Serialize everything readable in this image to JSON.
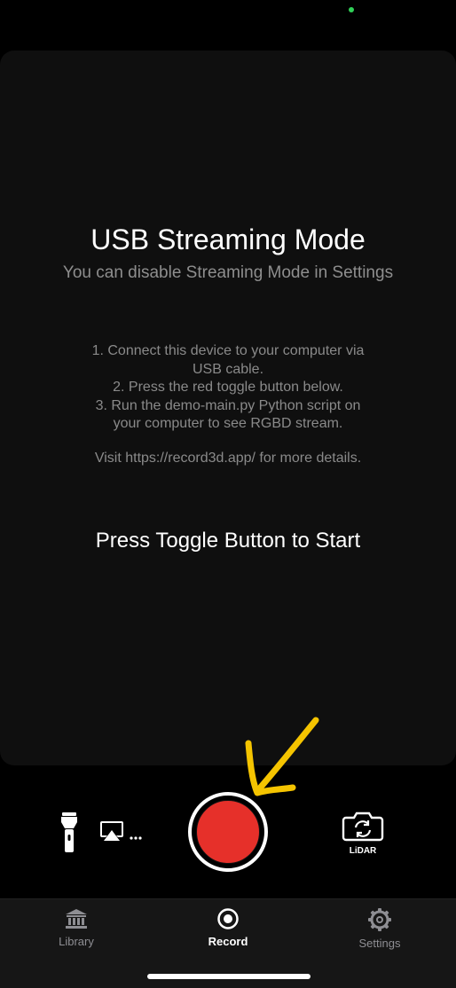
{
  "main": {
    "title": "USB Streaming Mode",
    "subtitle": "You can disable Streaming Mode in Settings",
    "instructions": [
      "1. Connect this device to your computer via\nUSB cable.",
      "2. Press the red toggle button below.",
      "3. Run the demo-main.py Python script on\nyour computer to see RGBD stream."
    ],
    "visit_text": "Visit https://record3d.app/ for more details.",
    "prompt": "Press Toggle Button to Start"
  },
  "controls": {
    "flashlight_icon": "flashlight-icon",
    "airplay_icon": "airplay-icon",
    "airplay_suffix": "...",
    "record_color": "#e6302a",
    "camera_switch_label": "LiDAR"
  },
  "tabbar": {
    "tabs": [
      {
        "label": "Library",
        "icon": "library-icon",
        "active": false
      },
      {
        "label": "Record",
        "icon": "record-icon",
        "active": true
      },
      {
        "label": "Settings",
        "icon": "gear-icon",
        "active": false
      }
    ]
  },
  "colors": {
    "accent_red": "#e6302a",
    "annotation_yellow": "#f5c400",
    "status_green": "#30d158"
  }
}
